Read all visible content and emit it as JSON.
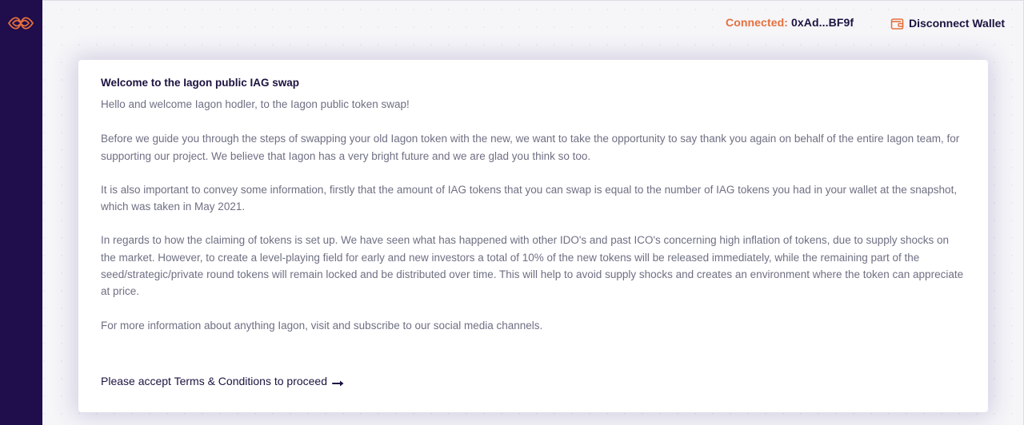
{
  "header": {
    "connected_label": "Connected:",
    "wallet_address": "0xAd...BF9f",
    "disconnect_label": "Disconnect Wallet",
    "disconnect_icon": "wallet-icon"
  },
  "sidebar": {
    "logo_icon": "iagon-logo-icon"
  },
  "card": {
    "title": "Welcome to the Iagon public IAG swap",
    "paragraphs": [
      "Hello and welcome Iagon hodler, to the Iagon public token swap!",
      "Before we guide you through the steps of swapping your old Iagon token with the new, we want to take the opportunity to say thank you again on behalf of the entire Iagon team, for supporting our project. We believe that Iagon has a very bright future and we are glad you think so too.",
      "It is also important to convey some information, firstly that the amount of IAG tokens that you can swap is equal to the number of IAG tokens you had in your wallet at the snapshot, which was taken in May 2021.",
      "In regards to how the claiming of tokens is set up. We have seen what has happened with other IDO's and past ICO's concerning high inflation of tokens, due to supply shocks on the market. However, to create a level-playing field for early and new investors a total of 10% of the new tokens will be released immediately, while the remaining part of the seed/strategic/private round tokens will remain locked and be distributed over time. This will help to avoid supply shocks and creates an environment where the token can appreciate at price.",
      "For more information about anything Iagon, visit and subscribe to our social media channels."
    ],
    "accept_label": "Please accept Terms & Conditions to proceed",
    "accept_icon": "arrow-right-icon"
  },
  "colors": {
    "sidebar": "#1f0d4c",
    "accent_orange": "#e5703d",
    "text_dark": "#1c1340",
    "text_body": "#6e7083"
  }
}
